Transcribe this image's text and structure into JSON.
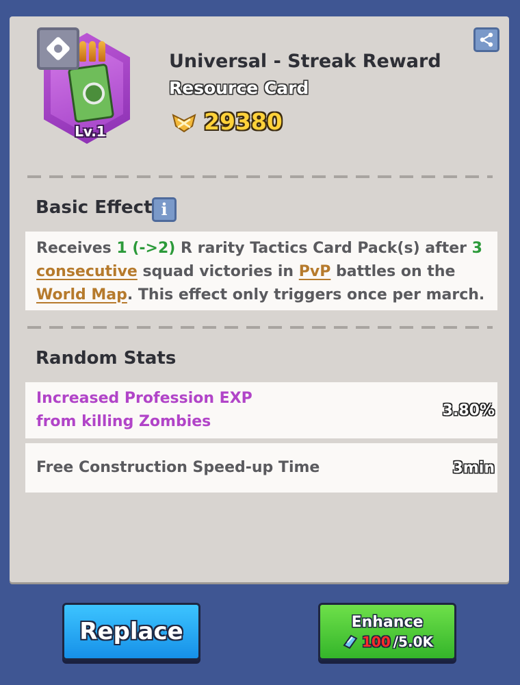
{
  "card": {
    "title": "Universal - Streak Reward",
    "type": "Resource Card",
    "level": "Lv.1",
    "power": "29380",
    "rarity_color": "#a443c8",
    "icon": "tactics-card-book-icon"
  },
  "basic_effect": {
    "heading": "Basic Effect",
    "info_symbol": "i",
    "parts": {
      "p1": "Receives ",
      "n1": "1 (->2)",
      "p2": " R rarity Tactics Card Pack(s) after ",
      "n2": "3",
      "l1": "consecutive",
      "p3": " squad victories in ",
      "l2": "PvP",
      "p4": " battles on the ",
      "l3": "World Map",
      "p5": ". This effect only triggers once per march."
    }
  },
  "random_stats": {
    "heading": "Random Stats",
    "rows": [
      {
        "name": "Increased Profession EXP from killing Zombies",
        "value": "3.80%",
        "color": "#b144c8"
      },
      {
        "name": "Free Construction Speed-up Time",
        "value": "3min",
        "color": "#5a5a5e"
      }
    ]
  },
  "buttons": {
    "replace": "Replace",
    "enhance": "Enhance",
    "cost_have": "100",
    "cost_need": "/5.0K",
    "cost_icon": "crystal-icon"
  }
}
